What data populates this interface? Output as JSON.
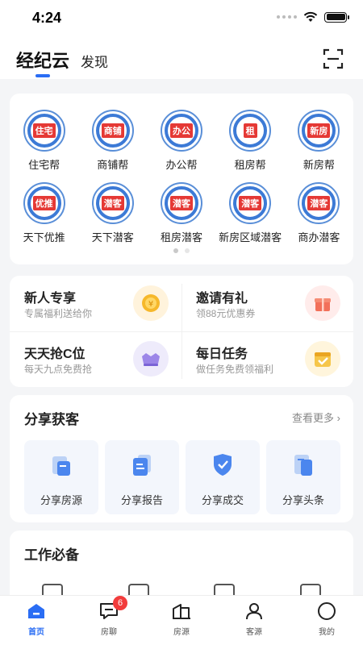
{
  "status": {
    "time": "4:24"
  },
  "header": {
    "tab_main": "经纪云",
    "tab_discover": "发现"
  },
  "apps": [
    {
      "logo": "住宅",
      "label": "住宅帮"
    },
    {
      "logo": "商铺",
      "label": "商铺帮"
    },
    {
      "logo": "办公",
      "label": "办公帮"
    },
    {
      "logo": "租",
      "label": "租房帮"
    },
    {
      "logo": "新房",
      "label": "新房帮"
    },
    {
      "logo": "优推",
      "label": "天下优推"
    },
    {
      "logo": "潜客",
      "label": "天下潜客"
    },
    {
      "logo": "潜客",
      "label": "租房潜客"
    },
    {
      "logo": "潜客",
      "label": "新房区域潜客"
    },
    {
      "logo": "潜客",
      "label": "商办潜客"
    }
  ],
  "promos": [
    {
      "title": "新人专享",
      "sub": "专属福利送给你",
      "icon": "coin-icon",
      "color": "#fff3dc"
    },
    {
      "title": "邀请有礼",
      "sub": "领88元优惠券",
      "icon": "gift-icon",
      "color": "#ffeceb"
    },
    {
      "title": "天天抢C位",
      "sub": "每天九点免费抢",
      "icon": "sofa-icon",
      "color": "#eeebfb"
    },
    {
      "title": "每日任务",
      "sub": "做任务免费领福利",
      "icon": "calendar-icon",
      "color": "#fff5dc"
    }
  ],
  "share": {
    "title": "分享获客",
    "more": "查看更多",
    "items": [
      {
        "label": "分享房源",
        "icon": "house-share-icon"
      },
      {
        "label": "分享报告",
        "icon": "report-icon"
      },
      {
        "label": "分享成交",
        "icon": "deal-shield-icon"
      },
      {
        "label": "分享头条",
        "icon": "headline-icon"
      }
    ]
  },
  "work": {
    "title": "工作必备"
  },
  "tabbar": [
    {
      "label": "首页",
      "icon": "home-icon",
      "active": true
    },
    {
      "label": "房聊",
      "icon": "chat-icon",
      "badge": "6"
    },
    {
      "label": "房源",
      "icon": "building-icon"
    },
    {
      "label": "客源",
      "icon": "person-icon"
    },
    {
      "label": "我的",
      "icon": "profile-circle-icon"
    }
  ],
  "colors": {
    "accent": "#2a6df4",
    "badge": "#f23c3c"
  }
}
